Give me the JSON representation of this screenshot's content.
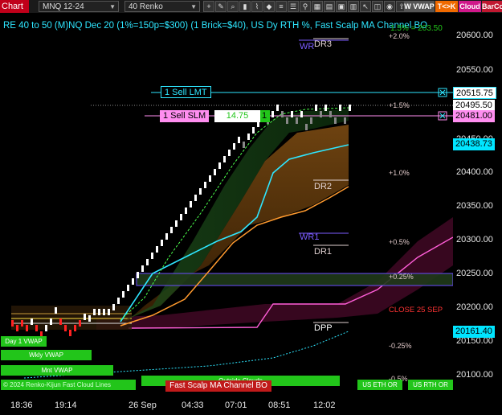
{
  "toolbar": {
    "chart_tab": "Chart",
    "instrument": "MNQ 12-24",
    "period": "40 Renko",
    "icons": [
      "crosshair-icon",
      "draw-tool-icon",
      "zoom-icon",
      "bar-style-icon",
      "indicators-icon",
      "strategy-icon",
      "properties-icon",
      "list-icon",
      "attach-icon",
      "grid-icon",
      "data-box-icon",
      "calendar-icon",
      "chart-trader-icon"
    ],
    "btn_wvwap": "W VWAP",
    "btn_tck": "T<>K",
    "btn_cloud": "Cloud",
    "btn_barcolor": "BarCo"
  },
  "chart": {
    "title": "RE 40 to 50 (M)NQ Dec 20 (1%=150p=$300) (1 Brick=$40), US Dy RTH %, Fast Scalp MA Channel BO",
    "title_overlay": "1.5% = 203.50",
    "bg_color": "#000000"
  },
  "price_axis": {
    "ticks": [
      "20600.00",
      "20550.00",
      "20500.00",
      "20450.00",
      "20400.00",
      "20350.00",
      "20300.00",
      "20250.00",
      "20200.00",
      "20150.00",
      "20100.00"
    ],
    "boxes": [
      {
        "label": "20515.75",
        "bg": "#ffffff",
        "fg": "#000000",
        "border": "#2ee6ff"
      },
      {
        "label": "20495.50",
        "bg": "#ffffff",
        "fg": "#000000",
        "border": "#ffffff"
      },
      {
        "label": "20481.00",
        "bg": "#ff8ef0",
        "fg": "#000000",
        "border": "#ff8ef0"
      },
      {
        "label": "20438.73",
        "bg": "#00e5ff",
        "fg": "#000000",
        "border": "#00e5ff"
      },
      {
        "label": "20161.40",
        "bg": "#00e5ff",
        "fg": "#000000",
        "border": "#00e5ff"
      }
    ]
  },
  "time_axis": {
    "ticks": [
      "18:36",
      "19:14",
      "26 Sep",
      "04:33",
      "07:01",
      "08:51",
      "12:02"
    ]
  },
  "orders": {
    "sell_lmt": "1 Sell LMT",
    "sell_slm": "1 Sell SLM",
    "slm_price": "14.75",
    "slm_qty": "1",
    "close_icon": "×"
  },
  "levels": {
    "dr3": "DR3",
    "wr_top": "WR",
    "dr2": "DR2",
    "wr1": "WR1",
    "dr1": "DR1",
    "dpp": "DPP",
    "close": "CLOSE 25 SEP"
  },
  "percent_levels": [
    "+2.0%",
    "+1.5%",
    "+1.0%",
    "+0.5%",
    "+0.25%",
    "-0.25%",
    "-0.5%"
  ],
  "bottom_buttons": {
    "day_vwap": "Day 1 VWAP",
    "wkly_vwap": "Wkly VWAP",
    "mnt_vwap": "Mnt VWAP",
    "copyright": "© 2024 Renko-Kijun Fast Cloud Lines",
    "outside_clouds": "Outside Clouds",
    "fast_scalp": "Fast Scalp MA Channel BO",
    "us_eth": "US ETH OR",
    "us_rth": "US RTH OR"
  },
  "colors": {
    "cyan": "#2ee6ff",
    "magenta": "#ff5ed8",
    "orange": "#ff9a2e",
    "green": "#22c51a",
    "red_close": "#ff3333"
  }
}
